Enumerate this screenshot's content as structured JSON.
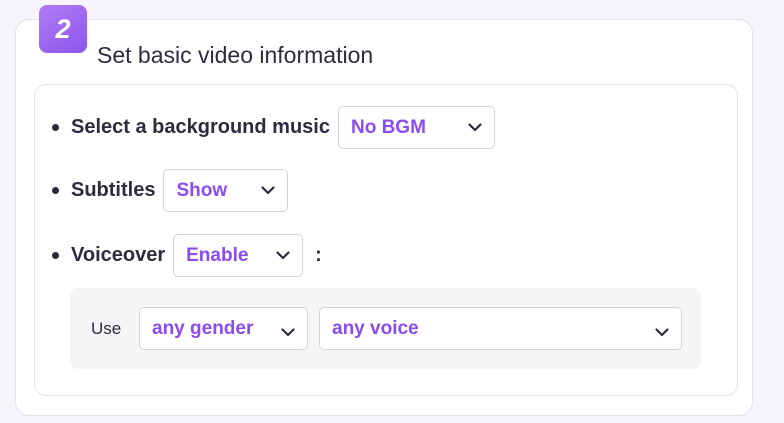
{
  "step": {
    "number": "2",
    "title": "Set basic video information"
  },
  "background_music": {
    "label": "Select a background music",
    "value": "No BGM"
  },
  "subtitles": {
    "label": "Subtitles",
    "value": "Show"
  },
  "voiceover": {
    "label": "Voiceover",
    "value": "Enable",
    "suffix": ":"
  },
  "voice_options": {
    "use_label": "Use",
    "gender": "any gender",
    "voice": "any voice"
  },
  "colors": {
    "accent": "#8a4bf0",
    "badge_start": "#b27cf5",
    "badge_end": "#8b55ee",
    "text": "#2e2b3d"
  }
}
